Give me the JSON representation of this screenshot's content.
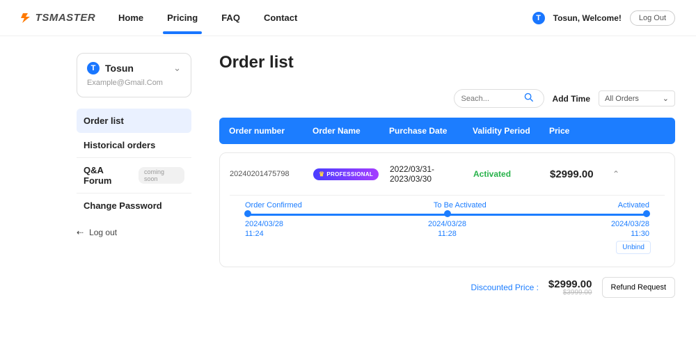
{
  "brand": "TSMASTER",
  "nav": {
    "home": "Home",
    "pricing": "Pricing",
    "faq": "FAQ",
    "contact": "Contact"
  },
  "top": {
    "welcome": "Tosun, Welcome!",
    "logout": "Log Out",
    "avatar": "T"
  },
  "sidebar": {
    "name": "Tosun",
    "email": "Example@Gmail.Com",
    "avatar": "T",
    "items": {
      "orders": "Order list",
      "hist": "Historical orders",
      "qa": "Q&A Forum",
      "soon": "coming soon",
      "cp": "Change Password"
    },
    "logout": "Log out"
  },
  "page": {
    "title": "Order list"
  },
  "controls": {
    "search_ph": "Seach...",
    "addtime": "Add Time",
    "sel": "All Orders"
  },
  "cols": {
    "num": "Order number",
    "name": "Order Name",
    "date": "Purchase Date",
    "valid": "Validity Period",
    "price": "Price"
  },
  "order": {
    "num": "20240201475798",
    "name": "PROFESSIONAL",
    "date": "2022/03/31-2023/03/30",
    "status": "Activated",
    "price": "$2999.00",
    "tl": {
      "step1": "Order Confirmed",
      "step2": "To Be Activated",
      "step3": "Activated",
      "d1": "2024/03/28",
      "d2": "2024/03/28",
      "d3": "2024/03/28",
      "t1": "11:24",
      "t2": "11:28",
      "t3": "11:30"
    },
    "unbind": "Unbind"
  },
  "foot": {
    "dp": "Discounted Price :",
    "price": "$2999.00",
    "strike": "$3999.00",
    "refund": "Refund Request"
  }
}
